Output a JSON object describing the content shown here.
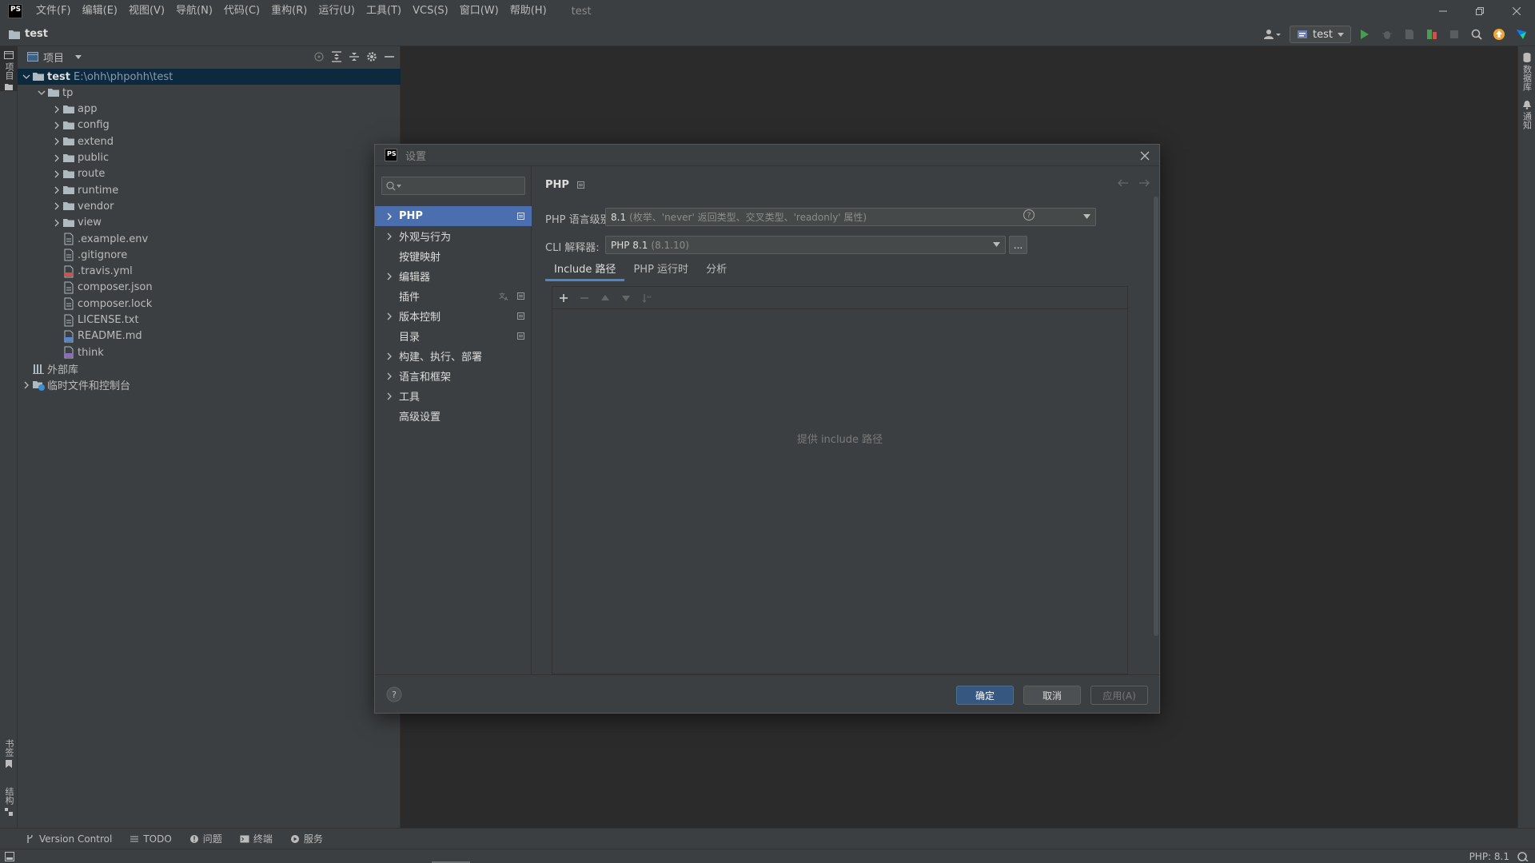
{
  "menubar": {
    "logo": "PS",
    "items": [
      "文件(F)",
      "编辑(E)",
      "视图(V)",
      "导航(N)",
      "代码(C)",
      "重构(R)",
      "运行(U)",
      "工具(T)",
      "VCS(S)",
      "窗口(W)",
      "帮助(H)"
    ],
    "window_title": "test"
  },
  "navbar": {
    "project": "test",
    "run_config": "test"
  },
  "left_strip": {
    "project_label": "项目",
    "bookmarks_label": "书签",
    "structure_label": "结构"
  },
  "right_strip": {
    "database_label": "数据库",
    "notifications_label": "通知"
  },
  "project_panel": {
    "title": "项目",
    "tree": [
      {
        "label": "test",
        "path": "E:\\ohh\\phpohh\\test",
        "depth": 0,
        "type": "folder",
        "expanded": true,
        "selected": true
      },
      {
        "label": "tp",
        "depth": 1,
        "type": "folder",
        "expanded": true
      },
      {
        "label": "app",
        "depth": 2,
        "type": "folder",
        "expanded": false
      },
      {
        "label": "config",
        "depth": 2,
        "type": "folder",
        "expanded": false
      },
      {
        "label": "extend",
        "depth": 2,
        "type": "folder",
        "expanded": false
      },
      {
        "label": "public",
        "depth": 2,
        "type": "folder",
        "expanded": false
      },
      {
        "label": "route",
        "depth": 2,
        "type": "folder",
        "expanded": false
      },
      {
        "label": "runtime",
        "depth": 2,
        "type": "folder",
        "expanded": false
      },
      {
        "label": "vendor",
        "depth": 2,
        "type": "folder",
        "expanded": false
      },
      {
        "label": "view",
        "depth": 2,
        "type": "folder",
        "expanded": false
      },
      {
        "label": ".example.env",
        "depth": 2,
        "type": "file"
      },
      {
        "label": ".gitignore",
        "depth": 2,
        "type": "file"
      },
      {
        "label": ".travis.yml",
        "depth": 2,
        "type": "yml"
      },
      {
        "label": "composer.json",
        "depth": 2,
        "type": "file"
      },
      {
        "label": "composer.lock",
        "depth": 2,
        "type": "file"
      },
      {
        "label": "LICENSE.txt",
        "depth": 2,
        "type": "file"
      },
      {
        "label": "README.md",
        "depth": 2,
        "type": "md"
      },
      {
        "label": "think",
        "depth": 2,
        "type": "script"
      },
      {
        "label": "外部库",
        "depth": 0,
        "type": "library",
        "leaf": true
      },
      {
        "label": "临时文件和控制台",
        "depth": 0,
        "type": "scratch",
        "expanded": false
      }
    ]
  },
  "dialog": {
    "logo": "PS",
    "title": "设置",
    "search_placeholder": "Q▾",
    "nav": [
      {
        "label": "PHP",
        "arrow": true,
        "selected": true,
        "badge": true
      },
      {
        "label": "外观与行为",
        "arrow": true
      },
      {
        "label": "按键映射",
        "arrow": false
      },
      {
        "label": "编辑器",
        "arrow": true
      },
      {
        "label": "插件",
        "arrow": false,
        "badge": true,
        "translate": true
      },
      {
        "label": "版本控制",
        "arrow": true,
        "badge": true
      },
      {
        "label": "目录",
        "arrow": false,
        "badge": true
      },
      {
        "label": "构建、执行、部署",
        "arrow": true
      },
      {
        "label": "语言和框架",
        "arrow": true
      },
      {
        "label": "工具",
        "arrow": true
      },
      {
        "label": "高级设置",
        "arrow": false
      }
    ],
    "breadcrumb": "PHP",
    "php_level_label": "PHP 语言级别:",
    "php_level_value": "8.1",
    "php_level_hint": "(枚举、'never' 返回类型、交叉类型、'readonly' 属性)",
    "cli_label": "CLI 解释器:",
    "cli_value": "PHP 8.1",
    "cli_hint": "(8.1.10)",
    "browse": "...",
    "tabs": [
      "Include 路径",
      "PHP 运行时",
      "分析"
    ],
    "active_tab": 0,
    "include_empty": "提供 include 路径",
    "buttons": {
      "ok": "确定",
      "cancel": "取消",
      "apply": "应用(A)"
    },
    "help": "?"
  },
  "bottom_tools": [
    "Version Control",
    "TODO",
    "问题",
    "终端",
    "服务"
  ],
  "status": {
    "php_version": "PHP: 8.1"
  },
  "colors": {
    "accent": "#4b6eaf",
    "primary_button": "#365880",
    "selection": "#0d293e",
    "run_green": "#499c54",
    "update_orange": "#f0a732"
  }
}
